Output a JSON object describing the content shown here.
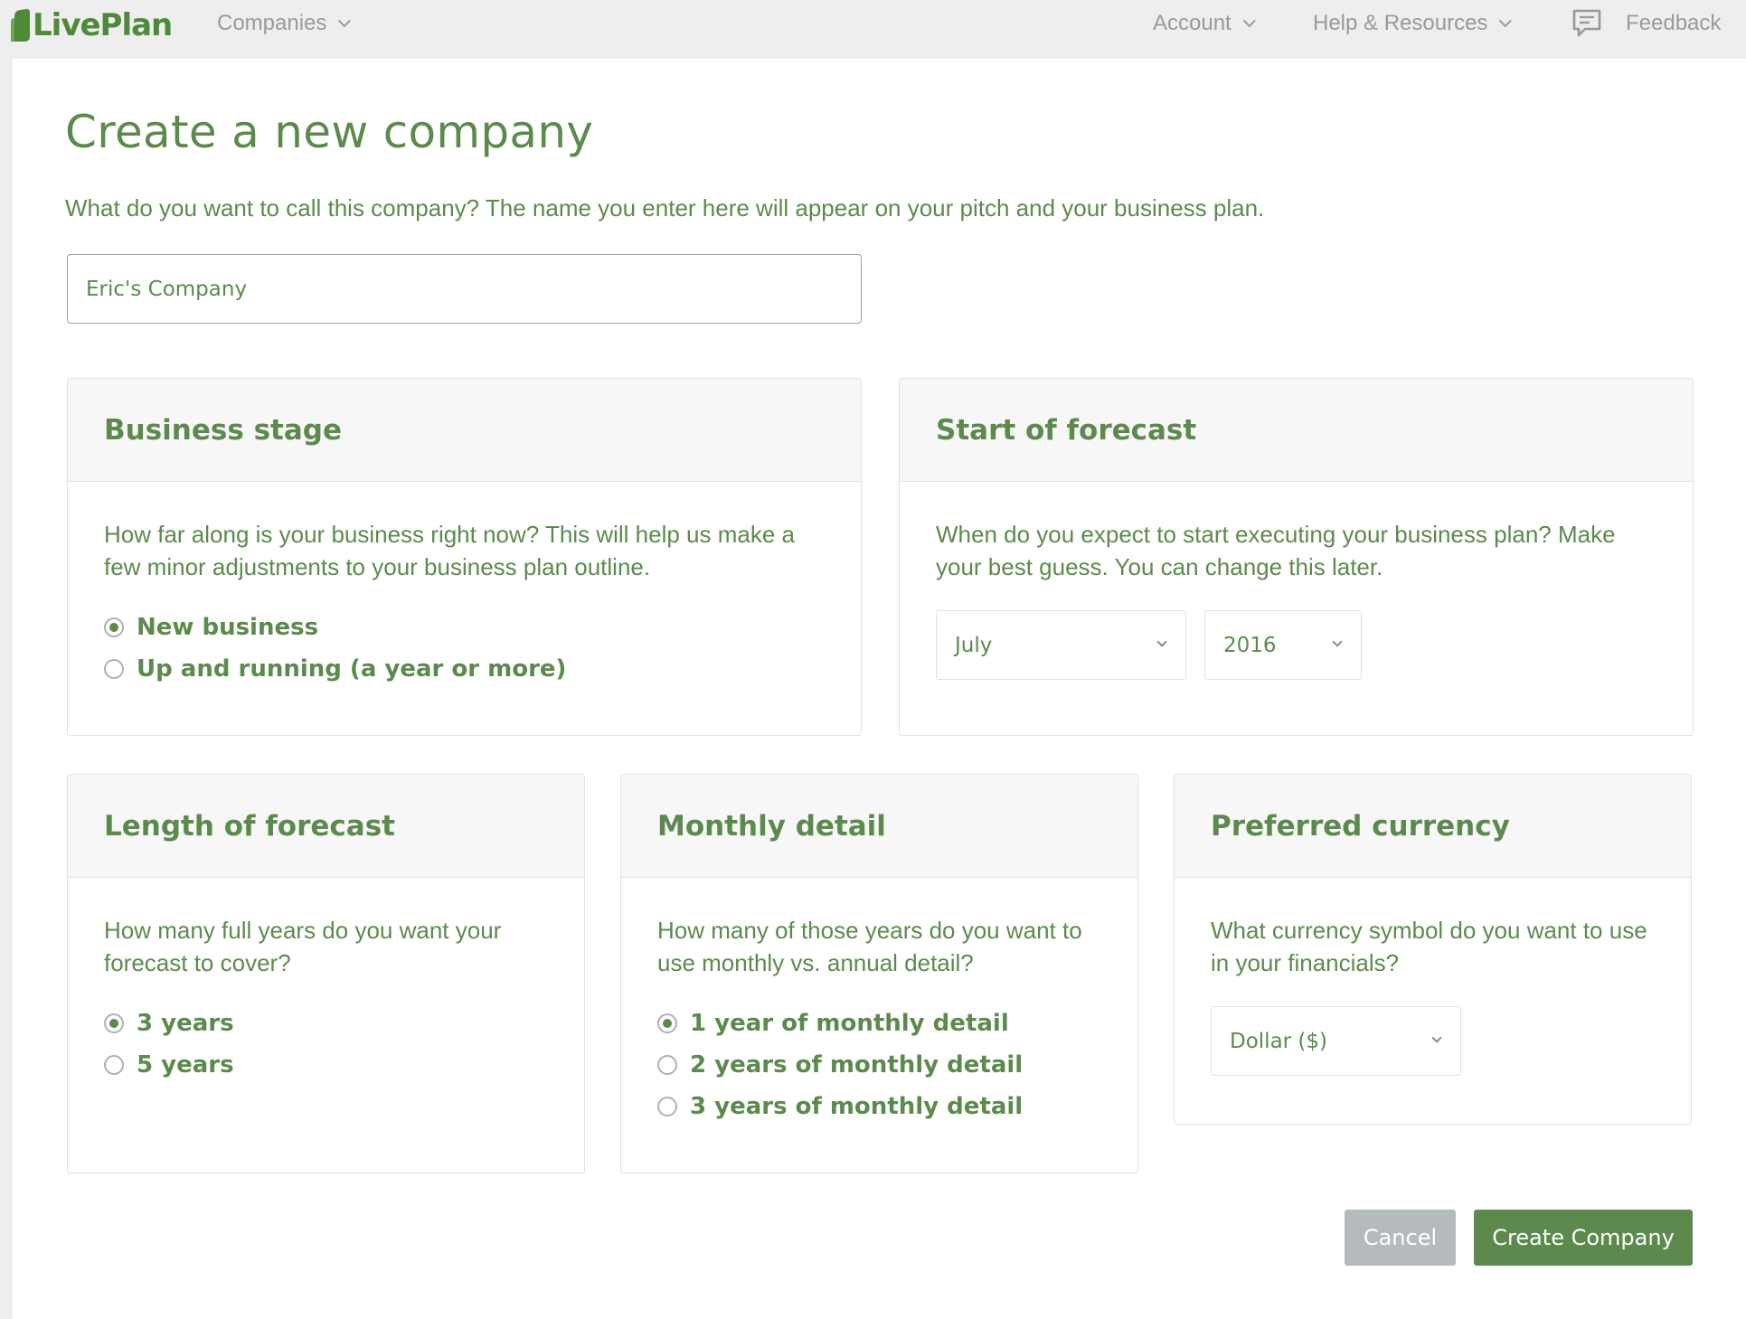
{
  "brand": {
    "logo_text": "LivePlan",
    "accent_color": "#5c8a4d"
  },
  "nav": {
    "companies_label": "Companies",
    "account_label": "Account",
    "help_label": "Help & Resources",
    "feedback_label": "Feedback"
  },
  "page": {
    "title": "Create a new company",
    "intro": "What do you want to call this company? The name you enter here will appear on your pitch and your business plan.",
    "company_name_value": "Eric's Company"
  },
  "business_stage": {
    "title": "Business stage",
    "description": "How far along is your business right now? This will help us make a few minor adjustments to your business plan outline.",
    "options": [
      {
        "label": "New business",
        "selected": true
      },
      {
        "label": "Up and running (a year or more)",
        "selected": false
      }
    ]
  },
  "start_of_forecast": {
    "title": "Start of forecast",
    "description": "When do you expect to start executing your business plan? Make your best guess. You can change this later.",
    "month_value": "July",
    "year_value": "2016"
  },
  "length_of_forecast": {
    "title": "Length of forecast",
    "description": "How many full years do you want your forecast to cover?",
    "options": [
      {
        "label": "3 years",
        "selected": true
      },
      {
        "label": "5 years",
        "selected": false
      }
    ]
  },
  "monthly_detail": {
    "title": "Monthly detail",
    "description": "How many of those years do you want to use monthly vs. annual detail?",
    "options": [
      {
        "label": "1 year of monthly detail",
        "selected": true
      },
      {
        "label": "2 years of monthly detail",
        "selected": false
      },
      {
        "label": "3 years of monthly detail",
        "selected": false
      }
    ]
  },
  "preferred_currency": {
    "title": "Preferred currency",
    "description": "What currency symbol do you want to use in your financials?",
    "currency_value": "Dollar ($)"
  },
  "actions": {
    "cancel_label": "Cancel",
    "create_label": "Create Company"
  }
}
